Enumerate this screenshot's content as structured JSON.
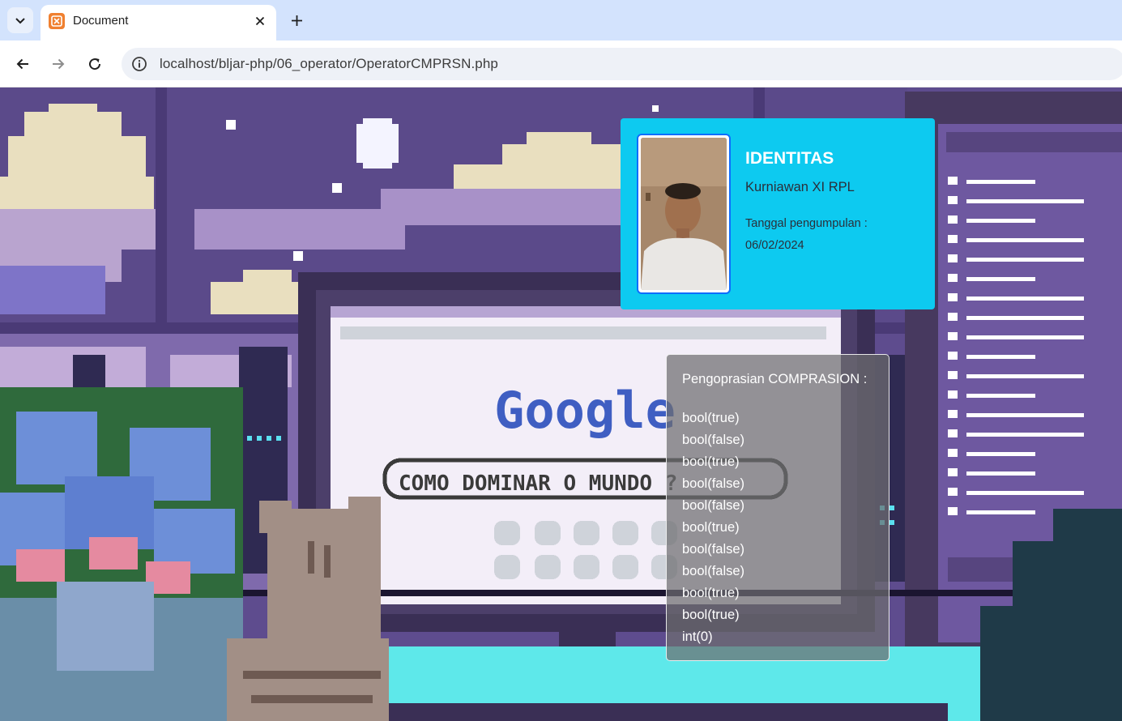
{
  "browser": {
    "tab_title": "Document",
    "url": "localhost/bljar-php/06_operator/OperatorCMPRSN.php"
  },
  "background": {
    "logo_text": "Google",
    "search_text": "COMO DOMINAR O MUNDO ?"
  },
  "identitas": {
    "title": "IDENTITAS",
    "name": "Kurniawan XI RPL",
    "date_label": "Tanggal pengumpulan :",
    "date": "06/02/2024"
  },
  "comparison": {
    "title": "Pengoprasian COMPRASION :",
    "results": [
      "bool(true)",
      "bool(false)",
      "bool(true)",
      "bool(false)",
      "bool(false)",
      "bool(true)",
      "bool(false)",
      "bool(false)",
      "bool(true)",
      "bool(true)",
      "int(0)"
    ]
  }
}
